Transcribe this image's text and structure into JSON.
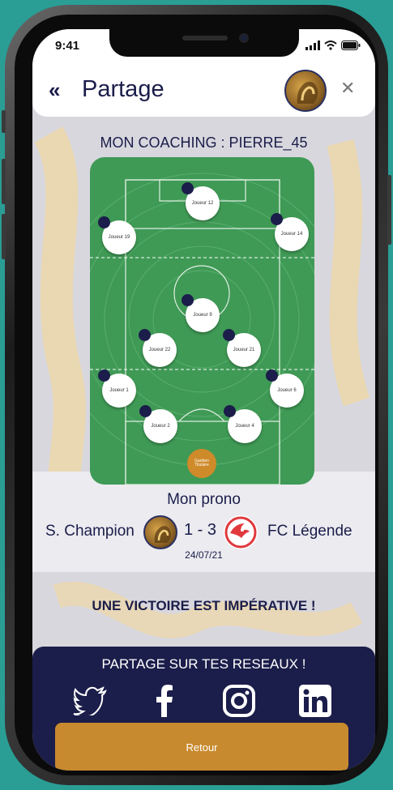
{
  "status": {
    "time": "9:41"
  },
  "header": {
    "back_icon": "«",
    "title": "Partage",
    "close_icon": "✕"
  },
  "coaching": {
    "title": "MON COACHING : PIERRE_45"
  },
  "players": [
    {
      "name": "Joueur 12"
    },
    {
      "name": "Joueur 19"
    },
    {
      "name": "Joueur 14"
    },
    {
      "name": "Joueur 9"
    },
    {
      "name": "Joueur 22"
    },
    {
      "name": "Joueur 21"
    },
    {
      "name": "Joueur 1"
    },
    {
      "name": "Joueur 6"
    },
    {
      "name": "Joueur 2"
    },
    {
      "name": "Joueur 4"
    }
  ],
  "goalkeeper": {
    "name": "Gardien Titulaire"
  },
  "prono": {
    "title": "Mon prono",
    "home_team": "S. Champion",
    "score": "1 - 3",
    "away_team": "FC Légende",
    "date": "24/07/21"
  },
  "slogan": "UNE VICTOIRE EST IMPÉRATIVE !",
  "share": {
    "title": "PARTAGE SUR TES RESEAUX !",
    "networks": [
      "twitter-icon",
      "facebook-icon",
      "instagram-icon",
      "linkedin-icon"
    ],
    "retour_label": "Retour"
  },
  "colors": {
    "navy": "#1b1d4a",
    "gold": "#c88a2e",
    "pitch": "#3f9a55",
    "background": "#2a9e95"
  }
}
